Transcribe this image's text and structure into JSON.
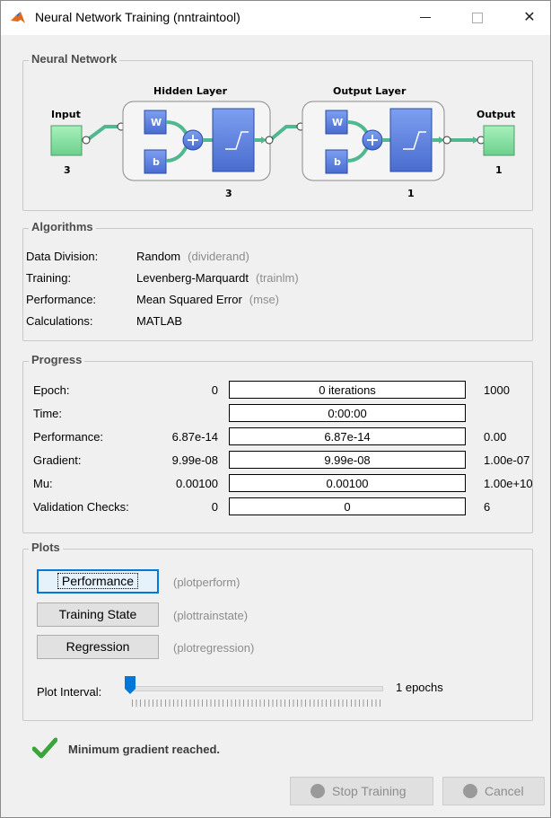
{
  "window": {
    "title": "Neural Network Training (nntraintool)"
  },
  "network": {
    "panel_title": "Neural Network",
    "input_label": "Input",
    "input_size": "3",
    "hidden_label": "Hidden Layer",
    "hidden_size": "3",
    "output_layer_label": "Output Layer",
    "output_layer_size": "1",
    "output_label": "Output",
    "output_size": "1",
    "weight_symbol": "W",
    "bias_symbol": "b",
    "colors": {
      "io_fill": "#8fe0a6",
      "block_fill": "#5b7fd9",
      "link": "#4fb88e"
    }
  },
  "algorithms": {
    "panel_title": "Algorithms",
    "rows": [
      {
        "key": "Data Division:",
        "value": "Random",
        "fn": "(dividerand)"
      },
      {
        "key": "Training:",
        "value": "Levenberg-Marquardt",
        "fn": "(trainlm)"
      },
      {
        "key": "Performance:",
        "value": "Mean Squared Error",
        "fn": "(mse)"
      },
      {
        "key": "Calculations:",
        "value": "MATLAB",
        "fn": ""
      }
    ]
  },
  "progress": {
    "panel_title": "Progress",
    "rows": [
      {
        "label": "Epoch:",
        "min": "0",
        "current": "0 iterations",
        "max": "1000"
      },
      {
        "label": "Time:",
        "min": "",
        "current": "0:00:00",
        "max": ""
      },
      {
        "label": "Performance:",
        "min": "6.87e-14",
        "current": "6.87e-14",
        "max": "0.00"
      },
      {
        "label": "Gradient:",
        "min": "9.99e-08",
        "current": "9.99e-08",
        "max": "1.00e-07"
      },
      {
        "label": "Mu:",
        "min": "0.00100",
        "current": "0.00100",
        "max": "1.00e+10"
      },
      {
        "label": "Validation Checks:",
        "min": "0",
        "current": "0",
        "max": "6"
      }
    ]
  },
  "plots": {
    "panel_title": "Plots",
    "buttons": [
      {
        "label": "Performance",
        "fn": "(plotperform)"
      },
      {
        "label": "Training State",
        "fn": "(plottrainstate)"
      },
      {
        "label": "Regression",
        "fn": "(plotregression)"
      }
    ],
    "interval_label": "Plot Interval:",
    "interval_value": "1 epochs",
    "interval_fraction": 0
  },
  "status": {
    "message": "Minimum gradient reached."
  },
  "buttons": {
    "stop": "Stop Training",
    "cancel": "Cancel"
  }
}
